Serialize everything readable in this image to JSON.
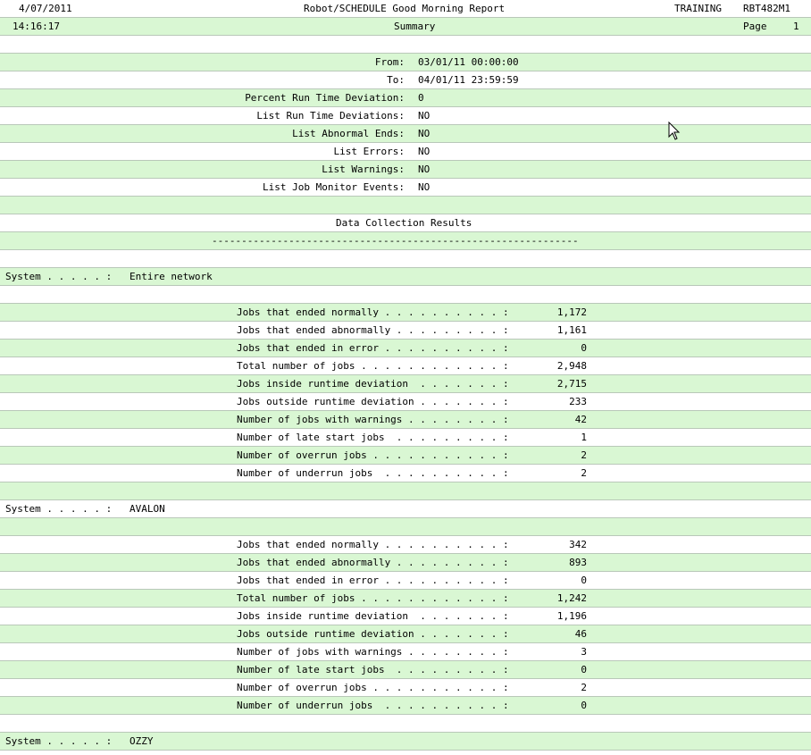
{
  "header": {
    "date": "4/07/2011",
    "title": "Robot/SCHEDULE Good Morning Report",
    "environment": "TRAINING",
    "report_id": "RBT482M1",
    "time": "14:16:17",
    "subtitle": "Summary",
    "page_label": "Page",
    "page_number": "1"
  },
  "params": [
    {
      "label": "From:",
      "value": "03/01/11 00:00:00"
    },
    {
      "label": "To:",
      "value": "04/01/11 23:59:59"
    },
    {
      "label": "Percent Run Time Deviation:",
      "value": "0"
    },
    {
      "label": "List Run Time Deviations:",
      "value": "NO"
    },
    {
      "label": "List Abnormal Ends:",
      "value": "NO"
    },
    {
      "label": "List Errors:",
      "value": "NO"
    },
    {
      "label": "List Warnings:",
      "value": "NO"
    },
    {
      "label": "List Job Monitor Events:",
      "value": "NO"
    }
  ],
  "section_title": "Data Collection Results",
  "separator": "--------------------------------------------------------------",
  "system_label": "System . . . . . :",
  "stat_labels": [
    "Jobs that ended normally . . . . . . . . . . :",
    "Jobs that ended abnormally . . . . . . . . . :",
    "Jobs that ended in error . . . . . . . . . . :",
    "Total number of jobs . . . . . . . . . . . . :",
    "Jobs inside runtime deviation  . . . . . . . :",
    "Jobs outside runtime deviation . . . . . . . :",
    "Number of jobs with warnings . . . . . . . . :",
    "Number of late start jobs  . . . . . . . . . :",
    "Number of overrun jobs . . . . . . . . . . . :",
    "Number of underrun jobs  . . . . . . . . . . :"
  ],
  "systems": [
    {
      "name": "Entire network",
      "values": [
        "1,172",
        "1,161",
        "0",
        "2,948",
        "2,715",
        "233",
        "42",
        "1",
        "2",
        "2"
      ]
    },
    {
      "name": "AVALON",
      "values": [
        "342",
        "893",
        "0",
        "1,242",
        "1,196",
        "46",
        "3",
        "0",
        "2",
        "0"
      ]
    },
    {
      "name": "OZZY",
      "values": []
    }
  ],
  "colors": {
    "band_green": "#d9f7d3",
    "band_white": "#ffffff",
    "rule": "#b9c8b9"
  }
}
